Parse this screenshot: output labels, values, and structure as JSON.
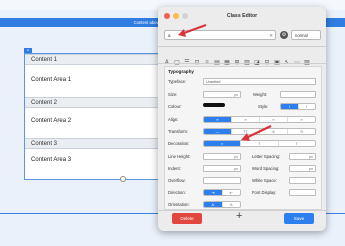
{
  "page": {
    "banner_text": "Content above this line will show on every",
    "selection_tag": "A"
  },
  "accordion": {
    "items": [
      {
        "header": "Content 1",
        "body": "Content Area 1"
      },
      {
        "header": "Content 2",
        "body": "Content Area 2"
      },
      {
        "header": "Content 3",
        "body": "Content Area 3"
      }
    ]
  },
  "dialog": {
    "title": "Class Editor",
    "class_value": "a",
    "state_value": "normal",
    "section": "Typography",
    "labels": {
      "typeface": "Typeface:",
      "size": "Size:",
      "weight": "Weight:",
      "colour": "Colour:",
      "style": "Style:",
      "align": "Align:",
      "transform": "Transform:",
      "decoration": "Decoration:",
      "line_height": "Line Height:",
      "letter_spacing": "Letter Spacing:",
      "indent": "Indent:",
      "word_spacing": "Word Spacing:",
      "overflow": "Overflow:",
      "white_space": "White Space:",
      "direction": "Direction:",
      "font_display": "Font Display:",
      "orientation": "Orientation:"
    },
    "typeface_value": "Unsetted",
    "unit": "px",
    "buttons": {
      "delete": "Delete",
      "save": "Save",
      "add": "+"
    }
  },
  "colors": {
    "accent": "#2d7ff0",
    "delete": "#e2473f",
    "banner": "#2f7de0",
    "arrow": "#d9343a"
  }
}
